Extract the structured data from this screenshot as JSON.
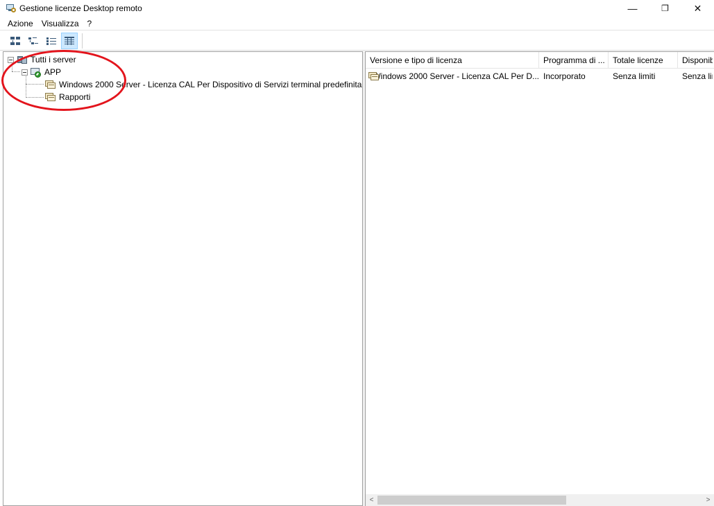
{
  "window": {
    "title": "Gestione licenze Desktop remoto",
    "controls": {
      "minimize": "—",
      "restore": "❐",
      "close": "✕"
    }
  },
  "menu": {
    "items": [
      "Azione",
      "Visualizza",
      "?"
    ]
  },
  "toolbar": {
    "buttons": [
      "large-icons-view",
      "small-icons-view",
      "list-view",
      "details-view"
    ],
    "active": "details-view"
  },
  "tree": {
    "root": {
      "label": "Tutti i server",
      "icon": "server-group-icon"
    },
    "server": {
      "label": "APP",
      "icon": "server-activated-icon"
    },
    "children": [
      {
        "label": "Windows 2000 Server - Licenza CAL Per Dispositivo di Servizi terminal predefinita",
        "icon": "license-icon"
      },
      {
        "label": "Rapporti",
        "icon": "reports-icon"
      }
    ]
  },
  "list": {
    "columns": [
      "Versione e tipo di licenza",
      "Programma di ...",
      "Totale licenze",
      "Disponibili"
    ],
    "rows": [
      [
        "Windows 2000 Server - Licenza CAL Per D...",
        "Incorporato",
        "Senza limiti",
        "Senza limiti"
      ]
    ]
  },
  "scrollbar": {
    "left_arrow": "<",
    "right_arrow": ">"
  },
  "colors": {
    "annotation": "#e3141c",
    "active_button": "#cce8ff"
  }
}
